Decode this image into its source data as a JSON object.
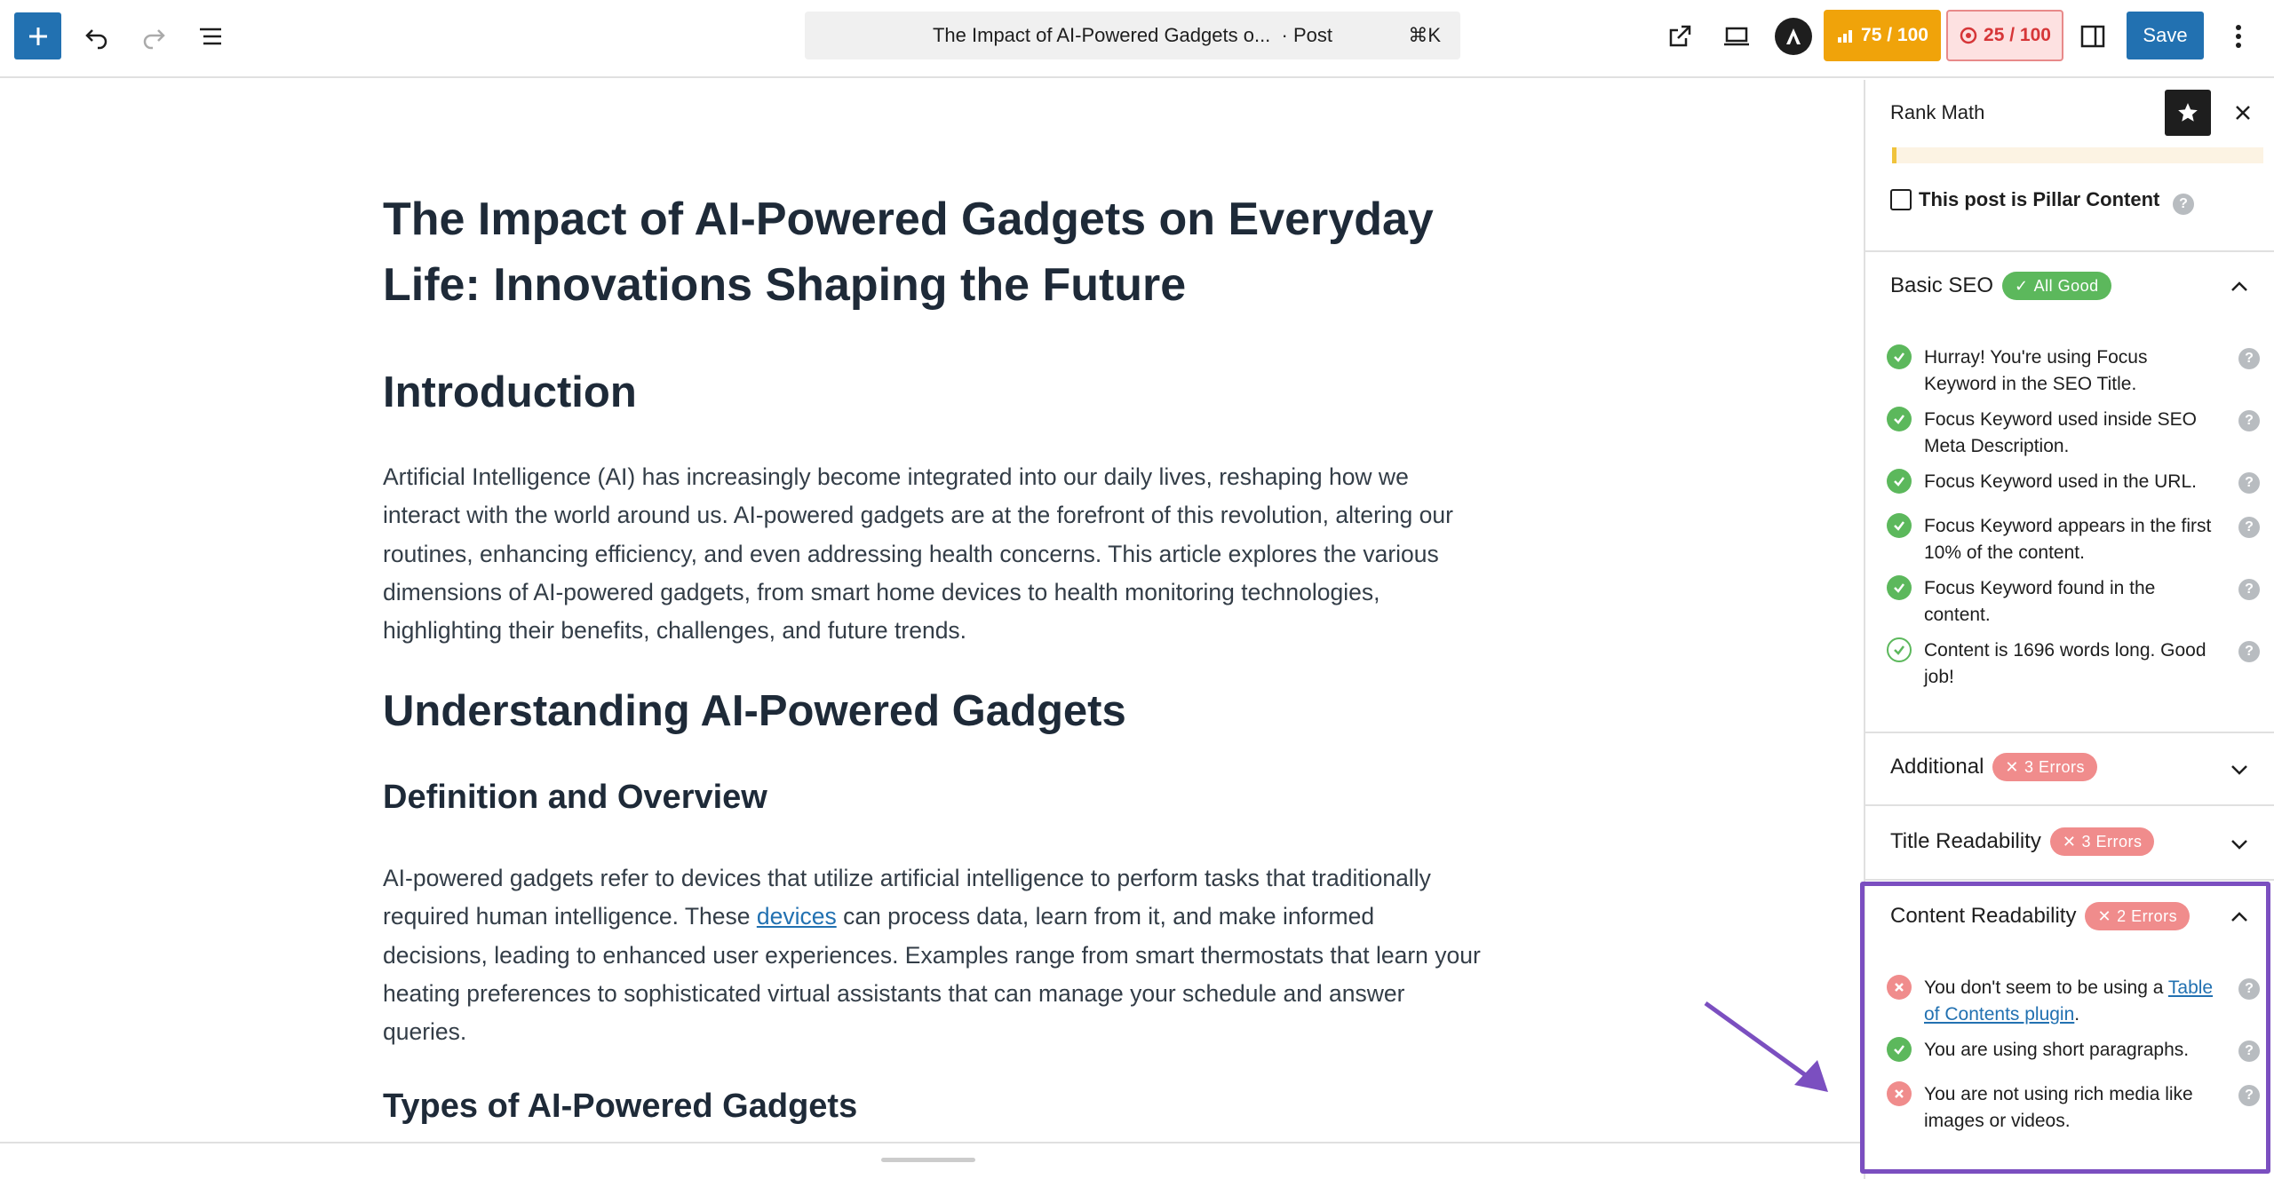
{
  "toolbar": {
    "document_title": "The Impact of AI-Powered Gadgets o...",
    "document_type": "· Post",
    "shortcut": "⌘K",
    "seo_score": "75 / 100",
    "readability_score": "25 / 100",
    "save_label": "Save"
  },
  "post": {
    "title": "The Impact of AI-Powered Gadgets on Everyday Life: Innovations Shaping the Future",
    "h2_intro": "Introduction",
    "p_intro": "Artificial Intelligence (AI) has increasingly become integrated into our daily lives, reshaping how we interact with the world around us. AI-powered gadgets are at the forefront of this revolution, altering our routines, enhancing efficiency, and even addressing health concerns. This article explores the various dimensions of AI-powered gadgets, from smart home devices to health monitoring technologies, highlighting their benefits, challenges, and future trends.",
    "h2_understanding": "Understanding AI-Powered Gadgets",
    "h3_definition": "Definition and Overview",
    "p_def_before": "AI-powered gadgets refer to devices that utilize artificial intelligence to perform tasks that traditionally required human intelligence. These ",
    "p_def_link": "devices",
    "p_def_after": " can process data, learn from it, and make informed decisions, leading to enhanced user experiences. Examples range from smart thermostats that learn your heating preferences to sophisticated virtual assistants that can manage your schedule and answer queries.",
    "h3_types": "Types of AI-Powered Gadgets"
  },
  "sidebar": {
    "title": "Rank Math",
    "pillar_label": "This post is Pillar Content",
    "basic_seo": {
      "title": "Basic SEO",
      "badge": "All Good",
      "items": [
        {
          "text": "Hurray! You're using Focus Keyword in the SEO Title.",
          "status": "ok"
        },
        {
          "text": "Focus Keyword used inside SEO Meta Description.",
          "status": "ok"
        },
        {
          "text": "Focus Keyword used in the URL.",
          "status": "ok"
        },
        {
          "text": "Focus Keyword appears in the first 10% of the content.",
          "status": "ok"
        },
        {
          "text": "Focus Keyword found in the content.",
          "status": "ok"
        },
        {
          "text": "Content is 1696 words long. Good job!",
          "status": "ok"
        }
      ]
    },
    "additional": {
      "title": "Additional",
      "badge": "3 Errors"
    },
    "title_readability": {
      "title": "Title Readability",
      "badge": "3 Errors"
    },
    "content_readability": {
      "title": "Content Readability",
      "badge": "2 Errors",
      "item1_before": "You don't seem to be using a ",
      "item1_link": "Table of Contents plugin",
      "item1_after": ".",
      "item2": "You are using short paragraphs.",
      "item3": "You are not using rich media like images or videos."
    }
  },
  "colors": {
    "accent": "#2271b1",
    "seo_score_bg": "#f0a30a",
    "good": "#5cb85c",
    "error": "#f08c8c",
    "highlight": "#7b4fc0"
  }
}
